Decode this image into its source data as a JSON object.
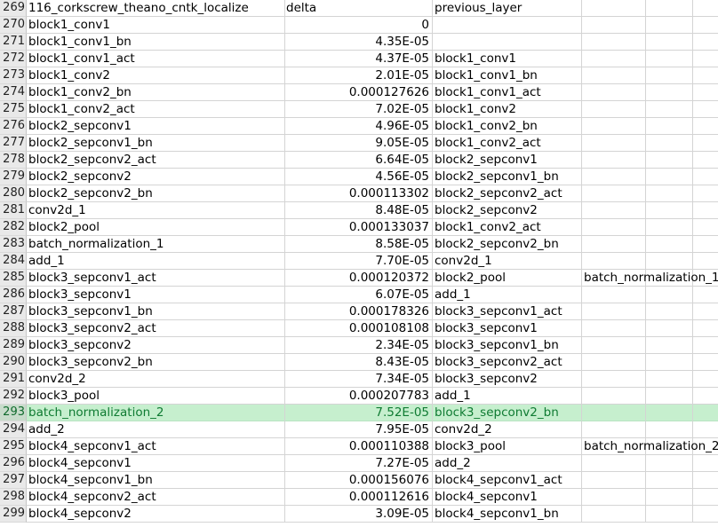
{
  "rows": [
    {
      "num": "269",
      "a": "116_corkscrew_theano_cntk_localize",
      "b": "delta",
      "b_align": "left",
      "c": "previous_layer",
      "d": ""
    },
    {
      "num": "270",
      "a": "block1_conv1",
      "b": "0",
      "c": "",
      "d": ""
    },
    {
      "num": "271",
      "a": "block1_conv1_bn",
      "b": "4.35E-05",
      "c": "",
      "d": ""
    },
    {
      "num": "272",
      "a": "block1_conv1_act",
      "b": "4.37E-05",
      "c": "block1_conv1",
      "d": ""
    },
    {
      "num": "273",
      "a": "block1_conv2",
      "b": "2.01E-05",
      "c": "block1_conv1_bn",
      "d": ""
    },
    {
      "num": "274",
      "a": "block1_conv2_bn",
      "b": "0.000127626",
      "c": "block1_conv1_act",
      "d": ""
    },
    {
      "num": "275",
      "a": "block1_conv2_act",
      "b": "7.02E-05",
      "c": "block1_conv2",
      "d": ""
    },
    {
      "num": "276",
      "a": "block2_sepconv1",
      "b": "4.96E-05",
      "c": "block1_conv2_bn",
      "d": ""
    },
    {
      "num": "277",
      "a": "block2_sepconv1_bn",
      "b": "9.05E-05",
      "c": "block1_conv2_act",
      "d": ""
    },
    {
      "num": "278",
      "a": "block2_sepconv2_act",
      "b": "6.64E-05",
      "c": "block2_sepconv1",
      "d": ""
    },
    {
      "num": "279",
      "a": "block2_sepconv2",
      "b": "4.56E-05",
      "c": "block2_sepconv1_bn",
      "d": ""
    },
    {
      "num": "280",
      "a": "block2_sepconv2_bn",
      "b": "0.000113302",
      "c": "block2_sepconv2_act",
      "d": ""
    },
    {
      "num": "281",
      "a": "conv2d_1",
      "b": "8.48E-05",
      "c": "block2_sepconv2",
      "d": ""
    },
    {
      "num": "282",
      "a": "block2_pool",
      "b": "0.000133037",
      "c": "block1_conv2_act",
      "d": ""
    },
    {
      "num": "283",
      "a": "batch_normalization_1",
      "b": "8.58E-05",
      "c": "block2_sepconv2_bn",
      "d": ""
    },
    {
      "num": "284",
      "a": "add_1",
      "b": "7.70E-05",
      "c": "conv2d_1",
      "d": ""
    },
    {
      "num": "285",
      "a": "block3_sepconv1_act",
      "b": "0.000120372",
      "c": "block2_pool",
      "d": "batch_normalization_1"
    },
    {
      "num": "286",
      "a": "block3_sepconv1",
      "b": "6.07E-05",
      "c": "add_1",
      "d": ""
    },
    {
      "num": "287",
      "a": "block3_sepconv1_bn",
      "b": "0.000178326",
      "c": "block3_sepconv1_act",
      "d": ""
    },
    {
      "num": "288",
      "a": "block3_sepconv2_act",
      "b": "0.000108108",
      "c": "block3_sepconv1",
      "d": ""
    },
    {
      "num": "289",
      "a": "block3_sepconv2",
      "b": "2.34E-05",
      "c": "block3_sepconv1_bn",
      "d": ""
    },
    {
      "num": "290",
      "a": "block3_sepconv2_bn",
      "b": "8.43E-05",
      "c": "block3_sepconv2_act",
      "d": ""
    },
    {
      "num": "291",
      "a": "conv2d_2",
      "b": "7.34E-05",
      "c": "block3_sepconv2",
      "d": ""
    },
    {
      "num": "292",
      "a": "block3_pool",
      "b": "0.000207783",
      "c": "add_1",
      "d": ""
    },
    {
      "num": "293",
      "a": "batch_normalization_2",
      "b": "7.52E-05",
      "c": "block3_sepconv2_bn",
      "d": "",
      "selected": true
    },
    {
      "num": "294",
      "a": "add_2",
      "b": "7.95E-05",
      "c": "conv2d_2",
      "d": ""
    },
    {
      "num": "295",
      "a": "block4_sepconv1_act",
      "b": "0.000110388",
      "c": "block3_pool",
      "d": "batch_normalization_2"
    },
    {
      "num": "296",
      "a": "block4_sepconv1",
      "b": "7.27E-05",
      "c": "add_2",
      "d": ""
    },
    {
      "num": "297",
      "a": "block4_sepconv1_bn",
      "b": "0.000156076",
      "c": "block4_sepconv1_act",
      "d": ""
    },
    {
      "num": "298",
      "a": "block4_sepconv2_act",
      "b": "0.000112616",
      "c": "block4_sepconv1",
      "d": ""
    },
    {
      "num": "299",
      "a": "block4_sepconv2",
      "b": "3.09E-05",
      "c": "block4_sepconv1_bn",
      "d": ""
    }
  ],
  "colors": {
    "grid": "#d4d4d4",
    "header_bg": "#e9e9e9",
    "selected_bg": "#c6efce",
    "selected_text": "#0f7b32"
  }
}
